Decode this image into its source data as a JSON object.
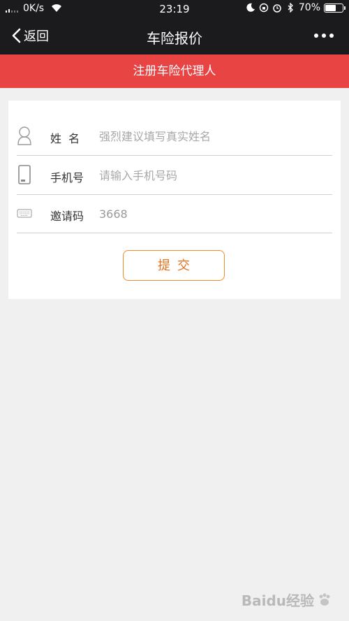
{
  "status_bar": {
    "network_speed": "0K/s",
    "time": "23:19",
    "battery_percent": "70%",
    "battery_level": 0.7
  },
  "nav": {
    "back_label": "返回",
    "title": "车险报价"
  },
  "banner": {
    "text": "注册车险代理人"
  },
  "form": {
    "name_label": "姓  名",
    "name_placeholder": "强烈建议填写真实姓名",
    "phone_label": "手机号",
    "phone_placeholder": "请输入手机号码",
    "invite_label": "邀请码",
    "invite_value": "3668",
    "submit_label": "提交"
  },
  "watermark": {
    "text": "Baidu经验"
  },
  "colors": {
    "nav_bg": "#1b1b1d",
    "banner_bg": "#e84444",
    "accent": "#ef8a2e",
    "page_bg": "#f0f0f0"
  }
}
